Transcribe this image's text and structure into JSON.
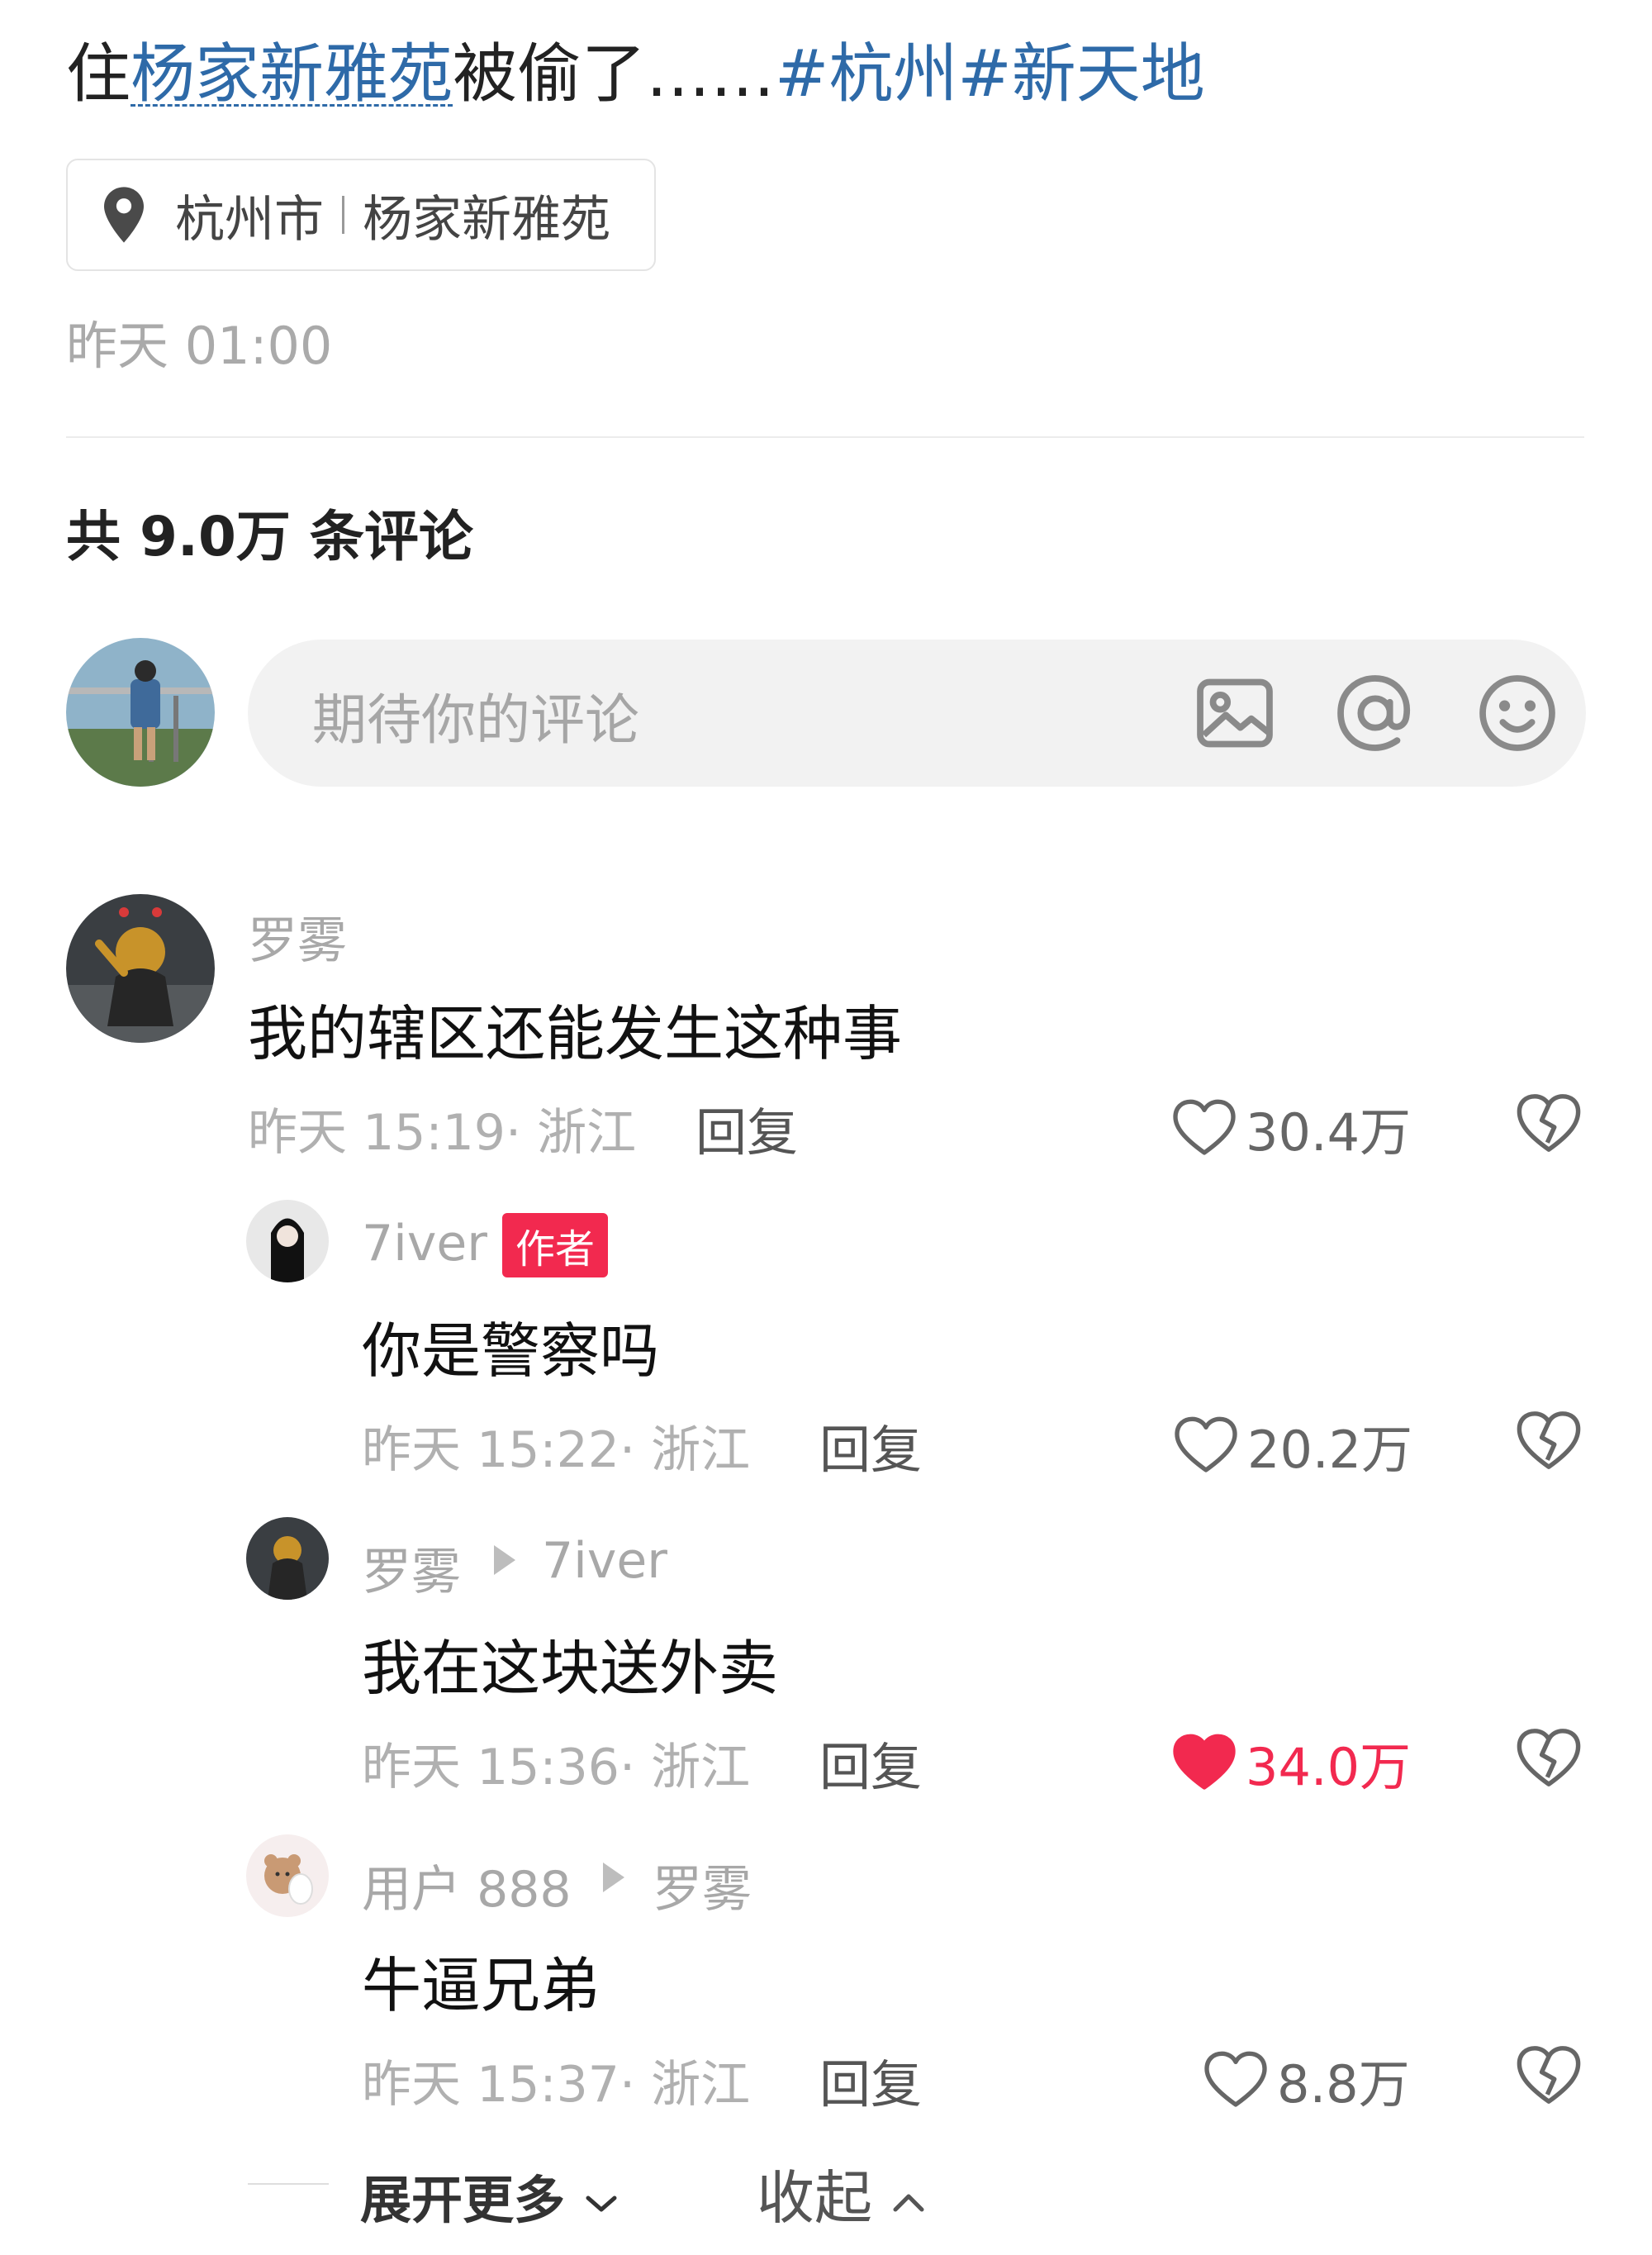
{
  "post": {
    "title_prefix": "住",
    "title_link": "杨家新雅苑",
    "title_middle": "被偷了……",
    "tags": [
      "#杭州",
      "#新天地"
    ],
    "location_city": "杭州市",
    "location_place": "杨家新雅苑",
    "time": "昨天 01:00"
  },
  "comments_header": {
    "prefix": "共",
    "count": "9.0万",
    "suffix": "条评论"
  },
  "composer": {
    "placeholder": "期待你的评论",
    "icons": [
      "image-icon",
      "at-icon",
      "emoji-icon"
    ]
  },
  "comments": [
    {
      "user": "罗雾",
      "text": "我的辖区还能发生这种事",
      "time": "昨天 15:19",
      "region": "浙江",
      "reply_label": "回复",
      "likes": "30.4万",
      "liked": false
    },
    {
      "user": "7iver",
      "badge": "作者",
      "text": "你是警察吗",
      "time": "昨天 15:22",
      "region": "浙江",
      "reply_label": "回复",
      "likes": "20.2万",
      "liked": false
    },
    {
      "user": "罗雾",
      "reply_to": "7iver",
      "text": "我在这块送外卖",
      "time": "昨天 15:36",
      "region": "浙江",
      "reply_label": "回复",
      "likes": "34.0万",
      "liked": true
    },
    {
      "user": "用户 888",
      "reply_to": "罗雾",
      "text": "牛逼兄弟",
      "time": "昨天 15:37",
      "region": "浙江",
      "reply_label": "回复",
      "likes": "8.8万",
      "liked": false
    }
  ],
  "footer": {
    "expand_label": "展开更多",
    "collapse_label": "收起"
  },
  "colors": {
    "link": "#2e6aa8",
    "accent": "#f2294f",
    "muted": "#b0b0b0"
  }
}
